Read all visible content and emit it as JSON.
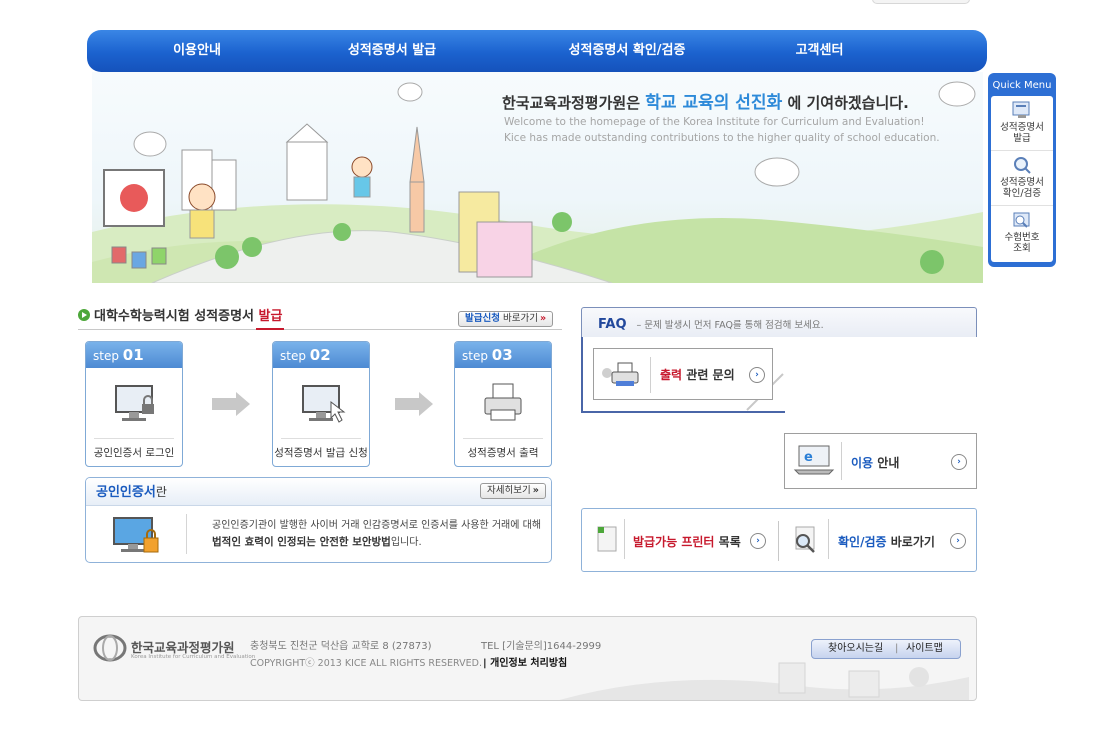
{
  "nav": {
    "items": [
      "이용안내",
      "성적증명서 발급",
      "성적증명서 확인/검증",
      "고객센터"
    ]
  },
  "hero": {
    "title_prefix": "한국교육과정평가원은",
    "title_highlight": "학교 교육의 선진화",
    "title_suffix": "에 기여하겠습니다.",
    "sub1": "Welcome to the homepage of the Korea Institute for Curriculum and Evaluation!",
    "sub2": "Kice has made outstanding contributions to the higher quality of school education."
  },
  "quick_menu": {
    "title": "Quick Menu",
    "items": [
      {
        "line1": "성적증명서",
        "line2": "발급"
      },
      {
        "line1": "성적증명서",
        "line2": "확인/검증"
      },
      {
        "line1": "수험번호",
        "line2": "조회"
      }
    ]
  },
  "issue_section": {
    "title_main": "대학수학능력시험 성적증명서",
    "title_highlight": "발급",
    "apply_btn_bold": "발급신청",
    "apply_btn_rest": "바로가기",
    "step_word": "step",
    "steps": [
      {
        "num": "01",
        "label": "공인인증서 로그인"
      },
      {
        "num": "02",
        "label": "성적증명서 발급 신청"
      },
      {
        "num": "03",
        "label": "성적증명서 출력"
      }
    ]
  },
  "cert_section": {
    "title": "공인인증서",
    "title_tail": "란",
    "more_btn": "자세히보기",
    "line1": "공인인증기관이 발행한 사이버 거래 인감증명서로 인증서를 사용한 거래에 대해",
    "line2_bold": "법적인 효력이 인정되는 안전한 보안방법",
    "line2_rest": "입니다."
  },
  "faq": {
    "title": "FAQ",
    "subtitle": "– 문제 발생시 먼저 FAQ를 통해 점검해 보세요.",
    "print_card": {
      "highlight": "출력",
      "rest": "관련 문의"
    },
    "usage_card": {
      "highlight": "이용",
      "rest": "안내"
    }
  },
  "bottom_links": {
    "printer": {
      "highlight": "발급가능 프린터",
      "rest": "목록"
    },
    "verify": {
      "highlight": "확인/검증",
      "rest": "바로가기"
    }
  },
  "footer": {
    "logo_text": "한국교육과정평가원",
    "logo_en": "Korea Institute for Curriculum and Evaluation",
    "address": "충청북도 진천군 덕산읍 교학로 8 (27873)",
    "tel": "TEL [기술문의]1644-2999",
    "copyright": "COPYRIGHTⓒ 2013 KICE ALL RIGHTS RESERVED.",
    "privacy": "개인정보 처리방침",
    "directions": "찾아오시는길",
    "sitemap": "사이트맵"
  },
  "colors": {
    "nav_blue": "#1b62cf",
    "highlight_red": "#c7192d",
    "link_blue": "#1a5bbf",
    "hero_highlight": "#2d8ad9"
  }
}
